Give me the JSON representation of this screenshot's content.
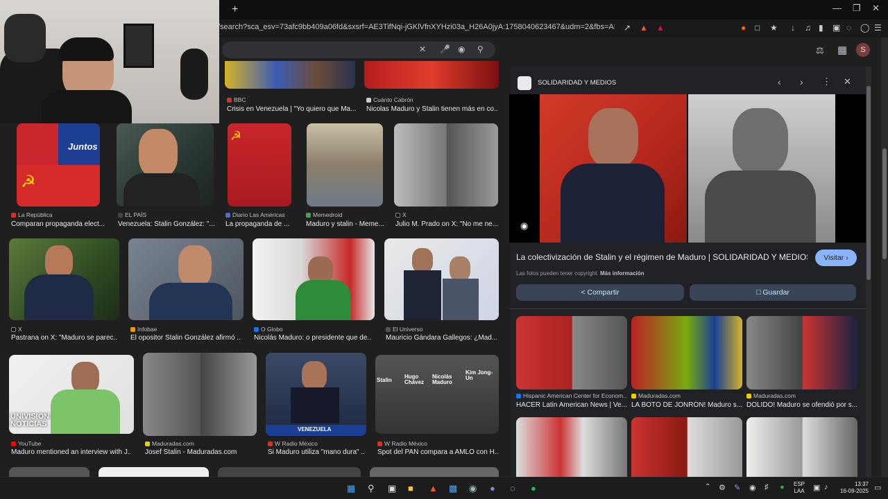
{
  "browser": {
    "url": "/search?sca_esv=73afc9bb409a06fd&sxsrf=AE3TifNqi-jGKlVfnXYHzi03a_H26A0jyA:1758040623467&udm=2&fbs=AIIjpHx4nJjfGojPVHhE...",
    "new_tab": "+",
    "profile_initial": "S"
  },
  "results": [
    {
      "source": "BBC",
      "caption": "Crisis en Venezuela | \"Yo quiero que Ma...",
      "color": "#d93025"
    },
    {
      "source": "Cuánto Cabrón",
      "caption": "Nicolas Maduro y Stalin tienen más en co...",
      "color": "#cccccc"
    },
    {
      "source": "La República",
      "caption": "Comparan propaganda elect...",
      "color": "#d93025"
    },
    {
      "source": "EL PAÍS",
      "caption": "Venezuela: Stalin González: \"...",
      "color": "#444444"
    },
    {
      "source": "Diario Las Américas",
      "caption": "La propaganda de ...",
      "color": "#4a6cd4"
    },
    {
      "source": "Memedroid",
      "caption": "Maduro y stalin - Meme...",
      "color": "#3aa757"
    },
    {
      "source": "X",
      "caption": "Julio M. Prado on X: \"No me ne...",
      "color": "#111111"
    },
    {
      "source": "X",
      "caption": "Pastrana on X: \"Maduro se parec...",
      "color": "#111111"
    },
    {
      "source": "Infobae",
      "caption": "El opositor Stalin González afirmó ...",
      "color": "#f29900"
    },
    {
      "source": "O Globo",
      "caption": "Nicolás Maduro: o presidente que de...",
      "color": "#1a73e8"
    },
    {
      "source": "El Universo",
      "caption": "Mauricio Gándara Gallegos: ¿Mad...",
      "color": "#555555"
    },
    {
      "source": "YouTube",
      "caption": "Maduro mentioned an interview with J...",
      "color": "#ff0000"
    },
    {
      "source": "Maduradas.com",
      "caption": "Josef Stalin - Maduradas.com",
      "color": "#e8d000"
    },
    {
      "source": "W Radio México",
      "caption": "Si Maduro utiliza \"mano dura\" ...",
      "color": "#d93025"
    },
    {
      "source": "W Radio México",
      "caption": "Spot del PAN compara a AMLO con H...",
      "color": "#d93025"
    }
  ],
  "thumb_text": {
    "juntos": "Juntos",
    "univision": "UNIVISION NOTICIAS",
    "venezuela": "VENEZUELA",
    "stalin": "Stalin",
    "hugo": "Hugo Chávez",
    "nicolas": "Nicolás Maduro",
    "kim": "Kim Jong-Un"
  },
  "panel": {
    "site": "SOLIDARIDAD Y MEDIOS",
    "title": "La colectivización de Stalin y el régimen de Maduro | SOLIDARIDAD Y MEDIOS",
    "visit": "Visitar",
    "copyright": "Las fotos pueden tener copyright.",
    "more_info": "Más información",
    "share": "Compartir",
    "save": "Guardar",
    "related": [
      {
        "source": "Hispanic American Center for Econom...",
        "caption": "HACER Latin American News | Ve...",
        "color": "#1a73e8"
      },
      {
        "source": "Maduradas.com",
        "caption": "LA BOTÓ DE JONRÓN! Maduro s...",
        "color": "#e8d000"
      },
      {
        "source": "Maduradas.com",
        "caption": "DOLIDO! Maduro se ofendió por s...",
        "color": "#e8d000"
      }
    ]
  },
  "taskbar": {
    "lang": "ESP",
    "layout": "LAA",
    "time": "13:37",
    "date": "16-09-2025"
  }
}
